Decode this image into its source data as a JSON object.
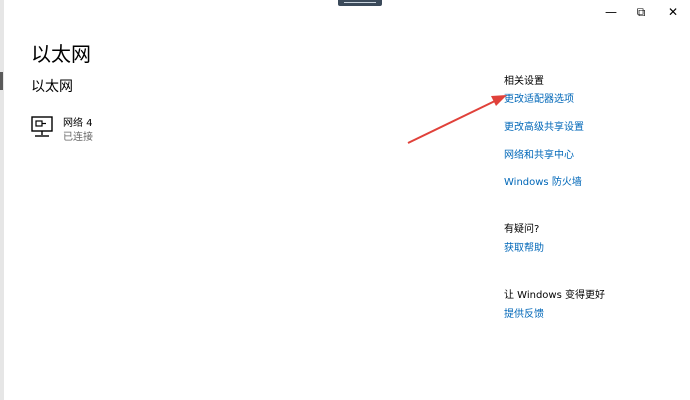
{
  "page": {
    "title": "以太网"
  },
  "section": {
    "title": "以太网"
  },
  "network": {
    "name": "网络 4",
    "status": "已连接",
    "icon": "network-pc-icon"
  },
  "related": {
    "heading": "相关设置",
    "links": [
      "更改适配器选项",
      "更改高级共享设置",
      "网络和共享中心",
      "Windows 防火墙"
    ]
  },
  "help": {
    "heading": "有疑问?",
    "link": "获取帮助"
  },
  "feedback": {
    "heading": "让 Windows 变得更好",
    "link": "提供反馈"
  },
  "window_controls": {
    "minimize": "—",
    "maximize": "⧉",
    "close": "✕"
  },
  "colors": {
    "link": "#0067b8",
    "annotation_arrow": "#e0413a"
  }
}
